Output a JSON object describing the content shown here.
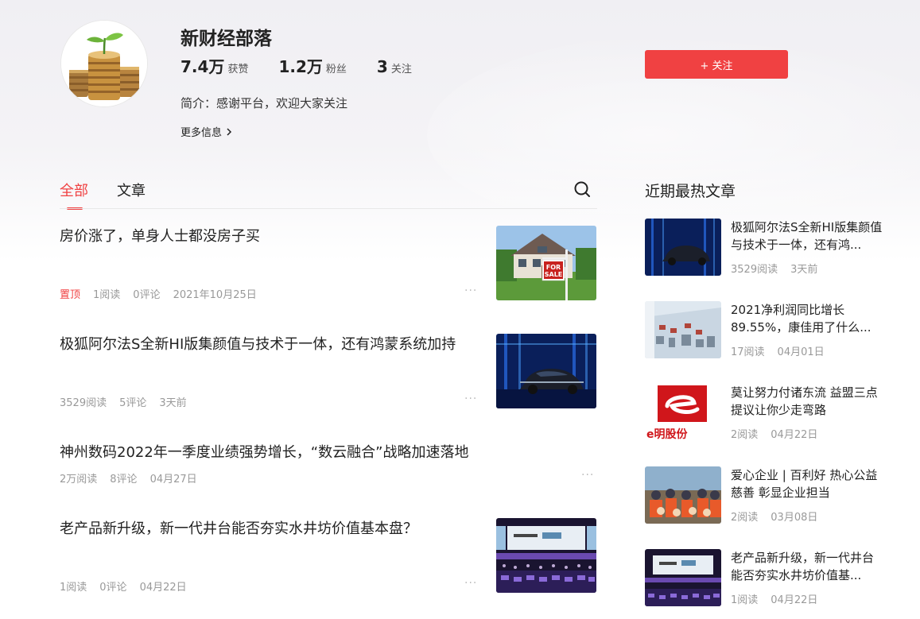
{
  "profile": {
    "name": "新财经部落",
    "stats": [
      {
        "value": "7.4万",
        "label": "获赞"
      },
      {
        "value": "1.2万",
        "label": "粉丝"
      },
      {
        "value": "3",
        "label": "关注"
      }
    ],
    "bio": "简介：感谢平台，欢迎大家关注",
    "more_info": "更多信息",
    "follow_label": "+ 关注"
  },
  "tabs": [
    {
      "label": "全部",
      "active": true
    },
    {
      "label": "文章",
      "active": false
    }
  ],
  "feed": [
    {
      "title": "房价涨了，单身人士都没房子买",
      "pin": "置顶",
      "reads": "1阅读",
      "comments": "0评论",
      "date": "2021年10月25日",
      "more": "···"
    },
    {
      "title": "极狐阿尔法S全新HI版集颜值与技术于一体，还有鸿蒙系统加持",
      "reads": "3529阅读",
      "comments": "5评论",
      "date": "3天前",
      "more": "···"
    },
    {
      "title": "神州数码2022年一季度业绩强势增长，“数云融合”战略加速落地",
      "reads": "2万阅读",
      "comments": "8评论",
      "date": "04月27日",
      "more": "···"
    },
    {
      "title": "老产品新升级，新一代井台能否夯实水井坊价值基本盘？",
      "reads": "1阅读",
      "comments": "0评论",
      "date": "04月22日",
      "more": "···"
    }
  ],
  "sidebar": {
    "title": "近期最热文章",
    "items": [
      {
        "title": "极狐阿尔法S全新HI版集颜值与技术于一体，还有鸿...",
        "reads": "3529阅读",
        "date": "3天前"
      },
      {
        "title": "2021净利润同比增长89.55%，康佳用了什么...",
        "reads": "17阅读",
        "date": "04月01日"
      },
      {
        "title": "莫让努力付诸东流 益盟三点提议让你少走弯路",
        "reads": "2阅读",
        "date": "04月22日"
      },
      {
        "title": "爱心企业 | 百利好 热心公益慈善 彰显企业担当",
        "reads": "2阅读",
        "date": "03月08日"
      },
      {
        "title": "老产品新升级，新一代井台能否夯实水井坊价值基...",
        "reads": "1阅读",
        "date": "04月22日"
      }
    ]
  },
  "images": {
    "sale_sign_line1": "FOR",
    "sale_sign_line2": "SALE",
    "logo_partial": "e明股份"
  },
  "colors": {
    "accent": "#f04142",
    "meta_gray": "#999999"
  },
  "icons": {
    "search": "search-icon",
    "more": "more-dots-icon",
    "chevron": "chevron-right-icon"
  }
}
